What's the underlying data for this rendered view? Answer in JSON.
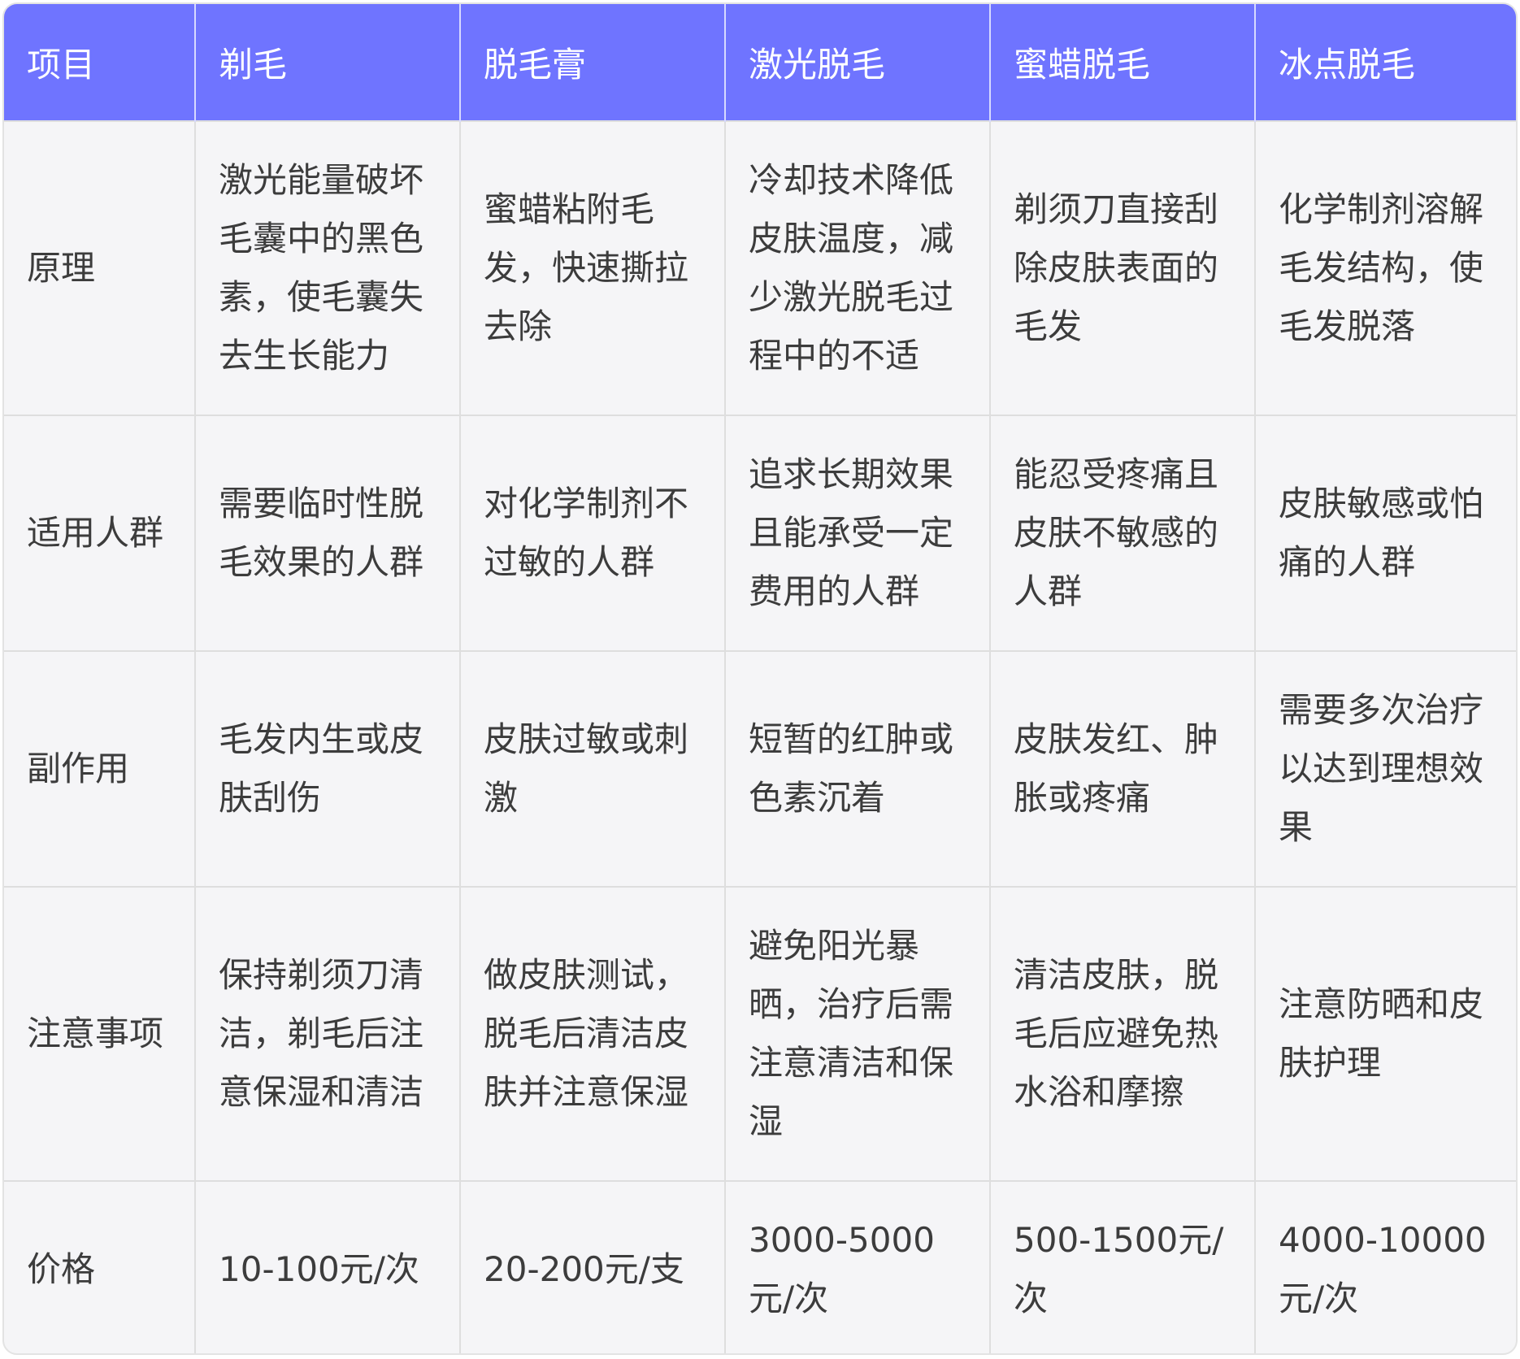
{
  "header": [
    "项目",
    "剃毛",
    "脱毛膏",
    "激光脱毛",
    "蜜蜡脱毛",
    "冰点脱毛"
  ],
  "rows": [
    {
      "label": "原理",
      "cells": [
        "激光能量破坏毛囊中的黑色素，使毛囊失去生长能力",
        "蜜蜡粘附毛发，快速撕拉去除",
        "冷却技术降低皮肤温度，减少激光脱毛过程中的不适",
        "剃须刀直接刮除皮肤表面的毛发",
        "化学制剂溶解毛发结构，使毛发脱落"
      ]
    },
    {
      "label": "适用人群",
      "cells": [
        "需要临时性脱毛效果的人群",
        "对化学制剂不过敏的人群",
        "追求长期效果且能承受一定费用的人群",
        "能忍受疼痛且皮肤不敏感的人群",
        "皮肤敏感或怕痛的人群"
      ]
    },
    {
      "label": "副作用",
      "cells": [
        "毛发内生或皮肤刮伤",
        "皮肤过敏或刺激",
        "短暂的红肿或色素沉着",
        "皮肤发红、肿胀或疼痛",
        "需要多次治疗以达到理想效果"
      ]
    },
    {
      "label": "注意事项",
      "cells": [
        "保持剃须刀清洁，剃毛后注意保湿和清洁",
        "做皮肤测试，脱毛后清洁皮肤并注意保湿",
        "避免阳光暴晒，治疗后需注意清洁和保湿",
        "清洁皮肤，脱毛后应避免热水浴和摩擦",
        "注意防晒和皮肤护理"
      ]
    },
    {
      "label": "价格",
      "cells": [
        "10-100元/次",
        "20-200元/支",
        "3000-5000元/次",
        "500-1500元/次",
        "4000-10000元/次"
      ]
    }
  ],
  "colors": {
    "header_bg": "#6f74ff",
    "header_text": "#ffffff",
    "body_bg": "#f5f5f7",
    "body_text": "#3c3c3c",
    "grid": "#dedede"
  }
}
